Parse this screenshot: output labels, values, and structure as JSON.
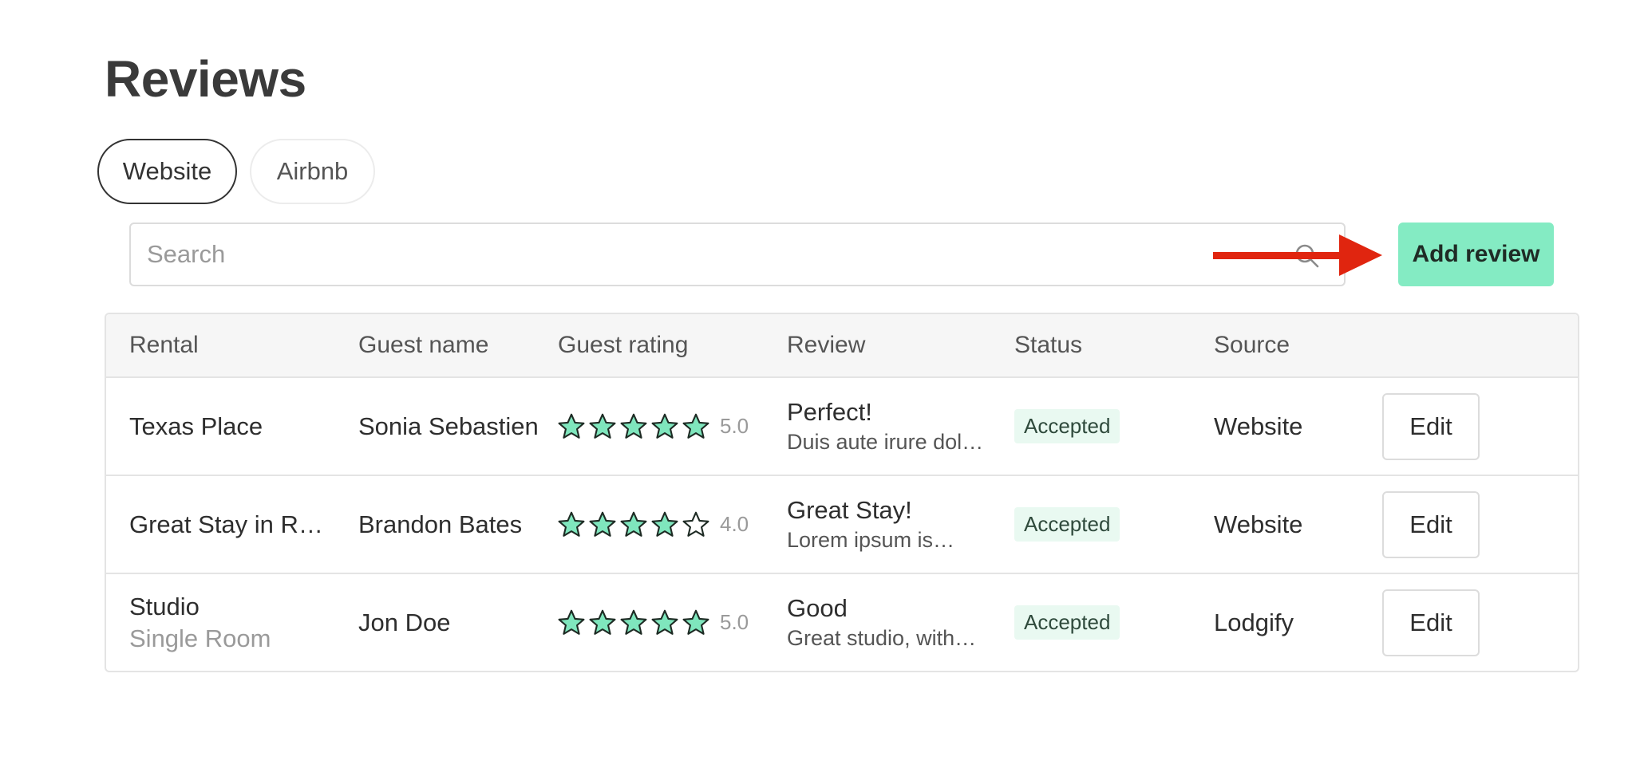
{
  "page": {
    "title": "Reviews"
  },
  "tabs": [
    {
      "label": "Website",
      "active": true
    },
    {
      "label": "Airbnb",
      "active": false
    }
  ],
  "search": {
    "placeholder": "Search",
    "value": "",
    "icon": "search-icon"
  },
  "add_review": {
    "label": "Add review",
    "color": "#84ebc3"
  },
  "annotation": {
    "icon": "arrow-right-icon",
    "color": "#e0250f"
  },
  "table": {
    "headers": [
      "Rental",
      "Guest name",
      "Guest rating",
      "Review",
      "Status",
      "Source",
      ""
    ],
    "rows": [
      {
        "rental": "Texas Place",
        "rental_sub": "",
        "guest": "Sonia Sebastien",
        "rating": 5,
        "rating_label": "5.0",
        "review_title": "Perfect!",
        "review_snippet": "Duis aute irure dol…",
        "status": "Accepted",
        "source": "Website",
        "action": "Edit"
      },
      {
        "rental": "Great Stay in Re…",
        "rental_sub": "",
        "guest": "Brandon Bates",
        "rating": 4,
        "rating_label": "4.0",
        "review_title": "Great Stay!",
        "review_snippet": "Lorem ipsum is…",
        "status": "Accepted",
        "source": "Website",
        "action": "Edit"
      },
      {
        "rental": "Studio",
        "rental_sub": "Single Room",
        "guest": "Jon Doe",
        "rating": 5,
        "rating_label": "5.0",
        "review_title": "Good",
        "review_snippet": "Great studio, with…",
        "status": "Accepted",
        "source": "Lodgify",
        "action": "Edit"
      }
    ]
  },
  "colors": {
    "star_fill": "#7fe6bd",
    "star_empty": "#ffffff",
    "star_stroke": "#1e2b24",
    "badge_bg": "#e9f9f1"
  }
}
